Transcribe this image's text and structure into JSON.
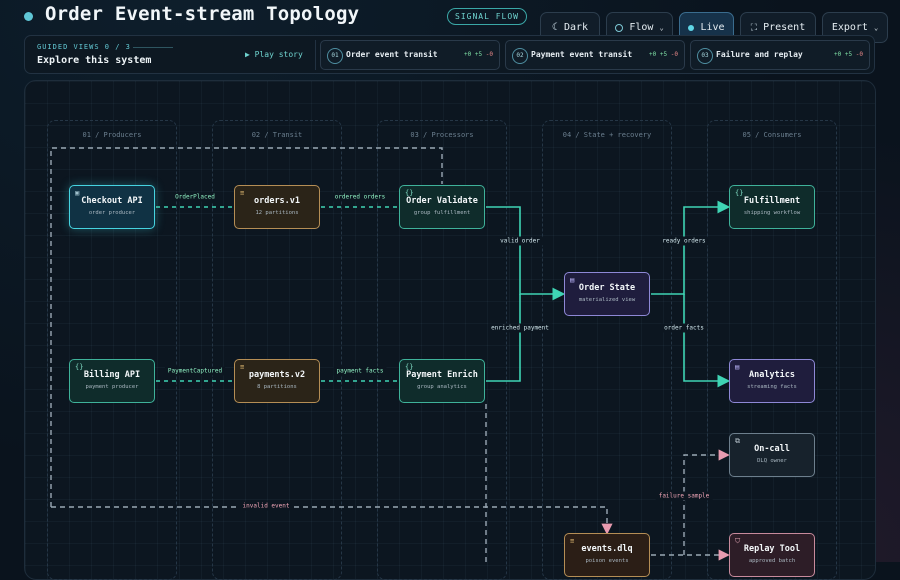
{
  "header": {
    "title": "Order Event-stream Topology",
    "badge": "SIGNAL FLOW"
  },
  "toolbar": {
    "dark_label": "Dark",
    "flow_label": "Flow",
    "live_label": "Live",
    "present_label": "Present",
    "export_label": "Export"
  },
  "guide": {
    "label": "GUIDED VIEWS 0 / 3",
    "subtitle": "Explore this system",
    "play_label": "▶ Play story",
    "stories": [
      {
        "num": "01",
        "label": "Order event transit",
        "plus": "+0",
        "mid": "+5",
        "minus": "-0"
      },
      {
        "num": "02",
        "label": "Payment event transit",
        "plus": "+0",
        "mid": "+5",
        "minus": "-0"
      },
      {
        "num": "03",
        "label": "Failure and replay",
        "plus": "+0",
        "mid": "+5",
        "minus": "-0"
      }
    ]
  },
  "lanes": [
    "01 / Producers",
    "02 / Transit",
    "03 / Processors",
    "04 / State + recovery",
    "05 / Consumers"
  ],
  "nodes": {
    "checkout_api": {
      "title": "Checkout API",
      "sub": "order producer"
    },
    "orders_v1": {
      "title": "orders.v1",
      "sub": "12 partitions"
    },
    "order_validate": {
      "title": "Order Validate",
      "sub": "group fulfillment"
    },
    "order_state": {
      "title": "Order State",
      "sub": "materialized view"
    },
    "fulfillment": {
      "title": "Fulfillment",
      "sub": "shipping workflow"
    },
    "billing_api": {
      "title": "Billing API",
      "sub": "payment producer"
    },
    "payments_v2": {
      "title": "payments.v2",
      "sub": "8 partitions"
    },
    "payment_enrich": {
      "title": "Payment Enrich",
      "sub": "group analytics"
    },
    "analytics": {
      "title": "Analytics",
      "sub": "streaming facts"
    },
    "oncall": {
      "title": "On-call",
      "sub": "DLQ owner"
    },
    "events_dlq": {
      "title": "events.dlq",
      "sub": "poison events"
    },
    "replay_tool": {
      "title": "Replay Tool",
      "sub": "approved batch"
    }
  },
  "edges": {
    "order_placed": "OrderPlaced",
    "ordered_orders": "ordered orders",
    "valid_order": "valid order",
    "ready_orders": "ready orders",
    "payment_captured": "PaymentCaptured",
    "payment_facts": "payment facts",
    "enriched_payment": "enriched payment",
    "order_facts": "order facts",
    "invalid_event": "invalid event",
    "failure_sample": "failure sample"
  },
  "colors": {
    "accent": "#46d3e0",
    "flow_green": "#3fd4b4",
    "failure_pink": "#f0a5b6"
  }
}
